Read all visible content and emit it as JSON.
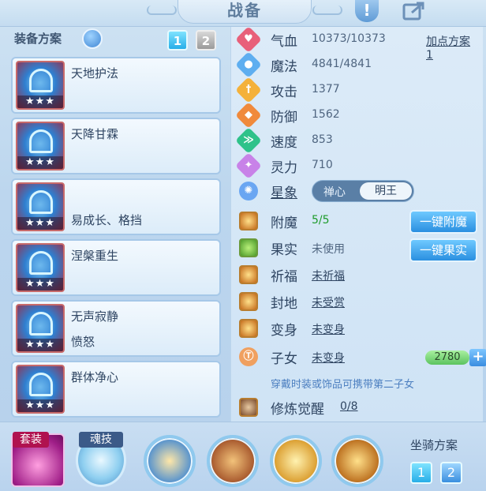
{
  "header": {
    "title": "战备",
    "info_icon": "!",
    "share_icon": "share-icon"
  },
  "left": {
    "plan_title": "装备方案",
    "plan_tabs": [
      "1",
      "2"
    ],
    "items": [
      {
        "name": "天地护法",
        "sub": "",
        "stars": "★★★"
      },
      {
        "name": "天降甘霖",
        "sub": "",
        "stars": "★★★"
      },
      {
        "name": "易成长、格挡",
        "sub": "",
        "stars": "★★★"
      },
      {
        "name": "涅槃重生",
        "sub": "",
        "stars": "★★★"
      },
      {
        "name": "无声寂静",
        "sub": "愤怒",
        "stars": "★★★"
      },
      {
        "name": "群体净心",
        "sub": "",
        "stars": "★★★"
      }
    ]
  },
  "stats": {
    "hp": {
      "label": "气血",
      "value": "10373/10373"
    },
    "mp": {
      "label": "魔法",
      "value": "4841/4841"
    },
    "atk": {
      "label": "攻击",
      "value": "1377"
    },
    "def": {
      "label": "防御",
      "value": "1562"
    },
    "spd": {
      "label": "速度",
      "value": "853"
    },
    "spirit": {
      "label": "灵力",
      "value": "710"
    },
    "point_plan": "加点方案1",
    "star": {
      "label": "星象",
      "opt1": "禅心",
      "opt2": "明王"
    }
  },
  "extras": {
    "enchant": {
      "label": "附魔",
      "value": "5/5",
      "button": "一键附魔"
    },
    "fruit": {
      "label": "果实",
      "value": "未使用",
      "button": "一键果实"
    },
    "bless": {
      "label": "祈福",
      "value": "未祈福"
    },
    "fief": {
      "label": "封地",
      "value": "未受赏"
    },
    "transform": {
      "label": "变身",
      "value": "未变身"
    },
    "children": {
      "label": "子女",
      "value": "未变身",
      "count": "2780",
      "plus": "+"
    },
    "note": "穿戴时装或饰品可携带第二子女",
    "cultivate": {
      "label": "修炼觉醒",
      "value": "0/8"
    }
  },
  "bottom": {
    "suit_label": "套装",
    "soul_label": "魂技",
    "mount_title": "坐骑方案",
    "mount_tabs": [
      "1",
      "2"
    ]
  },
  "colors": {
    "accent": "#27aee8",
    "green": "#1e9b2a",
    "note": "#4c7fc0"
  }
}
